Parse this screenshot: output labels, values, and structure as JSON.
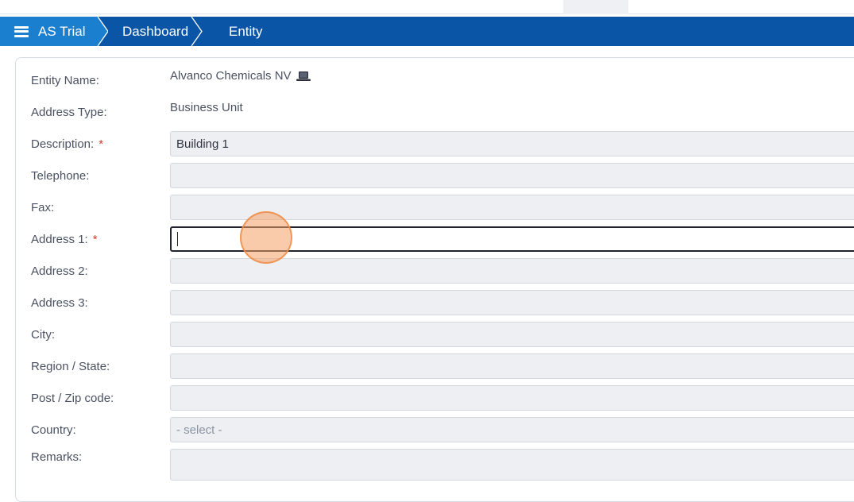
{
  "nav": {
    "app": "AS Trial",
    "crumbs": [
      "Dashboard",
      "Entity"
    ]
  },
  "form": {
    "entity_name_label": "Entity Name:",
    "entity_name_value": "Alvanco Chemicals NV",
    "address_type_label": "Address Type:",
    "address_type_value": "Business Unit",
    "description_label": "Description:",
    "description_value": "Building 1",
    "telephone_label": "Telephone:",
    "fax_label": "Fax:",
    "address1_label": "Address 1:",
    "address2_label": "Address 2:",
    "address3_label": "Address 3:",
    "city_label": "City:",
    "region_label": "Region / State:",
    "postcode_label": "Post / Zip code:",
    "country_label": "Country:",
    "country_value": "- select -",
    "remarks_label": "Remarks:",
    "required_mark": "*"
  },
  "colors": {
    "navbar": "#0a55a6",
    "home_crumb": "#1a7fcf",
    "required": "#d23b2d",
    "field_bg": "#edeff3"
  }
}
